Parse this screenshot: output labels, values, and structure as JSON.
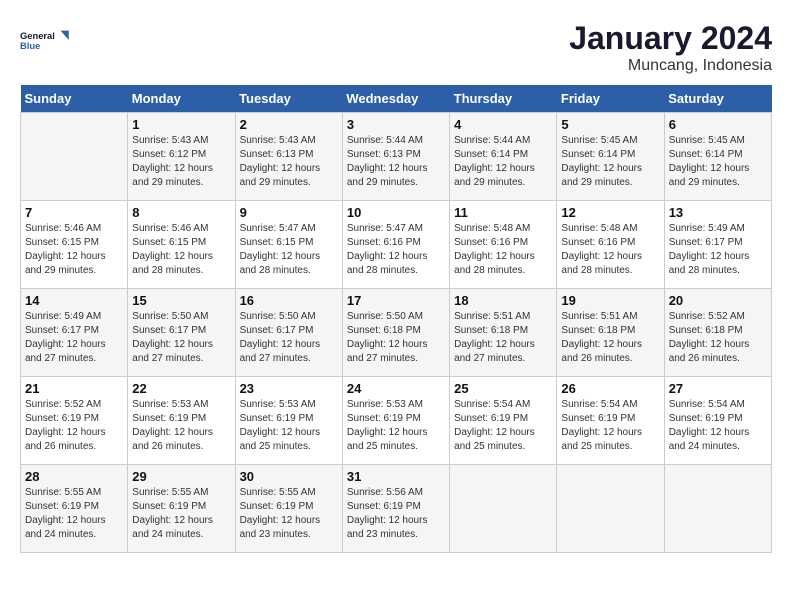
{
  "logo": {
    "line1": "General",
    "line2": "Blue"
  },
  "title": "January 2024",
  "location": "Muncang, Indonesia",
  "days_header": [
    "Sunday",
    "Monday",
    "Tuesday",
    "Wednesday",
    "Thursday",
    "Friday",
    "Saturday"
  ],
  "weeks": [
    [
      {
        "num": "",
        "info": ""
      },
      {
        "num": "1",
        "info": "Sunrise: 5:43 AM\nSunset: 6:12 PM\nDaylight: 12 hours\nand 29 minutes."
      },
      {
        "num": "2",
        "info": "Sunrise: 5:43 AM\nSunset: 6:13 PM\nDaylight: 12 hours\nand 29 minutes."
      },
      {
        "num": "3",
        "info": "Sunrise: 5:44 AM\nSunset: 6:13 PM\nDaylight: 12 hours\nand 29 minutes."
      },
      {
        "num": "4",
        "info": "Sunrise: 5:44 AM\nSunset: 6:14 PM\nDaylight: 12 hours\nand 29 minutes."
      },
      {
        "num": "5",
        "info": "Sunrise: 5:45 AM\nSunset: 6:14 PM\nDaylight: 12 hours\nand 29 minutes."
      },
      {
        "num": "6",
        "info": "Sunrise: 5:45 AM\nSunset: 6:14 PM\nDaylight: 12 hours\nand 29 minutes."
      }
    ],
    [
      {
        "num": "7",
        "info": "Sunrise: 5:46 AM\nSunset: 6:15 PM\nDaylight: 12 hours\nand 29 minutes."
      },
      {
        "num": "8",
        "info": "Sunrise: 5:46 AM\nSunset: 6:15 PM\nDaylight: 12 hours\nand 28 minutes."
      },
      {
        "num": "9",
        "info": "Sunrise: 5:47 AM\nSunset: 6:15 PM\nDaylight: 12 hours\nand 28 minutes."
      },
      {
        "num": "10",
        "info": "Sunrise: 5:47 AM\nSunset: 6:16 PM\nDaylight: 12 hours\nand 28 minutes."
      },
      {
        "num": "11",
        "info": "Sunrise: 5:48 AM\nSunset: 6:16 PM\nDaylight: 12 hours\nand 28 minutes."
      },
      {
        "num": "12",
        "info": "Sunrise: 5:48 AM\nSunset: 6:16 PM\nDaylight: 12 hours\nand 28 minutes."
      },
      {
        "num": "13",
        "info": "Sunrise: 5:49 AM\nSunset: 6:17 PM\nDaylight: 12 hours\nand 28 minutes."
      }
    ],
    [
      {
        "num": "14",
        "info": "Sunrise: 5:49 AM\nSunset: 6:17 PM\nDaylight: 12 hours\nand 27 minutes."
      },
      {
        "num": "15",
        "info": "Sunrise: 5:50 AM\nSunset: 6:17 PM\nDaylight: 12 hours\nand 27 minutes."
      },
      {
        "num": "16",
        "info": "Sunrise: 5:50 AM\nSunset: 6:17 PM\nDaylight: 12 hours\nand 27 minutes."
      },
      {
        "num": "17",
        "info": "Sunrise: 5:50 AM\nSunset: 6:18 PM\nDaylight: 12 hours\nand 27 minutes."
      },
      {
        "num": "18",
        "info": "Sunrise: 5:51 AM\nSunset: 6:18 PM\nDaylight: 12 hours\nand 27 minutes."
      },
      {
        "num": "19",
        "info": "Sunrise: 5:51 AM\nSunset: 6:18 PM\nDaylight: 12 hours\nand 26 minutes."
      },
      {
        "num": "20",
        "info": "Sunrise: 5:52 AM\nSunset: 6:18 PM\nDaylight: 12 hours\nand 26 minutes."
      }
    ],
    [
      {
        "num": "21",
        "info": "Sunrise: 5:52 AM\nSunset: 6:19 PM\nDaylight: 12 hours\nand 26 minutes."
      },
      {
        "num": "22",
        "info": "Sunrise: 5:53 AM\nSunset: 6:19 PM\nDaylight: 12 hours\nand 26 minutes."
      },
      {
        "num": "23",
        "info": "Sunrise: 5:53 AM\nSunset: 6:19 PM\nDaylight: 12 hours\nand 25 minutes."
      },
      {
        "num": "24",
        "info": "Sunrise: 5:53 AM\nSunset: 6:19 PM\nDaylight: 12 hours\nand 25 minutes."
      },
      {
        "num": "25",
        "info": "Sunrise: 5:54 AM\nSunset: 6:19 PM\nDaylight: 12 hours\nand 25 minutes."
      },
      {
        "num": "26",
        "info": "Sunrise: 5:54 AM\nSunset: 6:19 PM\nDaylight: 12 hours\nand 25 minutes."
      },
      {
        "num": "27",
        "info": "Sunrise: 5:54 AM\nSunset: 6:19 PM\nDaylight: 12 hours\nand 24 minutes."
      }
    ],
    [
      {
        "num": "28",
        "info": "Sunrise: 5:55 AM\nSunset: 6:19 PM\nDaylight: 12 hours\nand 24 minutes."
      },
      {
        "num": "29",
        "info": "Sunrise: 5:55 AM\nSunset: 6:19 PM\nDaylight: 12 hours\nand 24 minutes."
      },
      {
        "num": "30",
        "info": "Sunrise: 5:55 AM\nSunset: 6:19 PM\nDaylight: 12 hours\nand 23 minutes."
      },
      {
        "num": "31",
        "info": "Sunrise: 5:56 AM\nSunset: 6:19 PM\nDaylight: 12 hours\nand 23 minutes."
      },
      {
        "num": "",
        "info": ""
      },
      {
        "num": "",
        "info": ""
      },
      {
        "num": "",
        "info": ""
      }
    ]
  ]
}
